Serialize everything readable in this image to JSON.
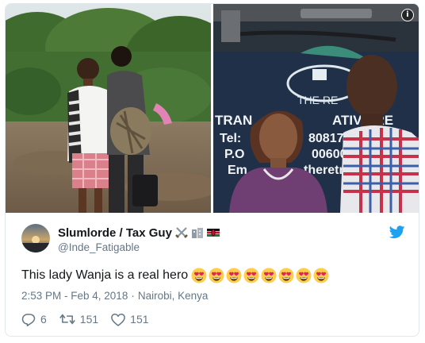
{
  "tweet": {
    "display_name": "Slumlorde / Tax Guy",
    "handle": "@Inde_Fatigable",
    "text": "This lady Wanja is a real hero",
    "emoji_count": 8,
    "timestamp": "2:53 PM - Feb 4, 2018",
    "meta_separator": "·",
    "location": "Nairobi, Kenya",
    "replies": "6",
    "retweets": "151",
    "likes": "151"
  },
  "media": {
    "sign_lines": [
      "THE RE",
      "TRAN",
      "ATIVE RE",
      "Tel:",
      "8081739",
      "P.O",
      "00600",
      "Em",
      "theretr"
    ]
  },
  "colors": {
    "brand_blue": "#1da1f2",
    "muted": "#657786",
    "text": "#14171a",
    "border": "#e1e8ed"
  },
  "icons": {
    "info": "info-icon",
    "bird": "twitter-bird-icon",
    "reply": "reply-icon",
    "retweet": "retweet-icon",
    "like": "heart-icon"
  }
}
